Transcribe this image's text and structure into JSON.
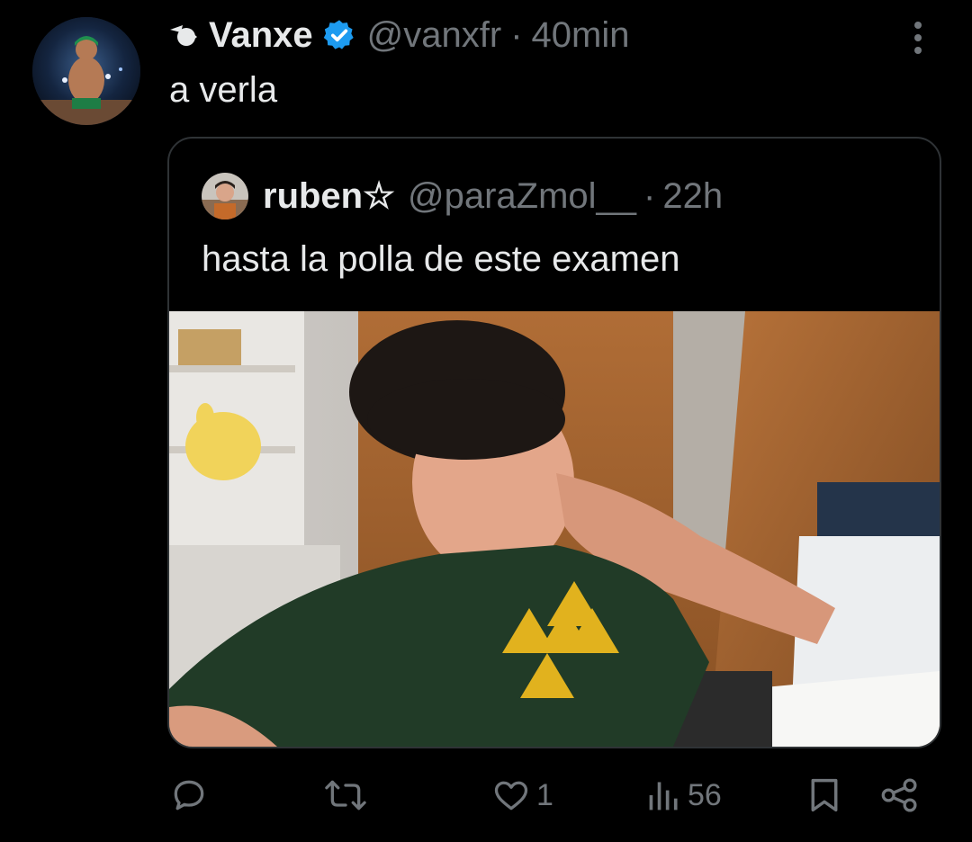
{
  "tweet": {
    "display_name": "Vanxe",
    "handle": "@vanxfr",
    "separator": "·",
    "time": "40min",
    "text": "a verla",
    "verified": true
  },
  "quoted_tweet": {
    "display_name": "ruben☆",
    "handle": "@paraZmol__",
    "separator": "·",
    "time": "22h",
    "text": "hasta la polla de este examen"
  },
  "actions": {
    "reply": {
      "icon": "reply-icon",
      "count": ""
    },
    "retweet": {
      "icon": "retweet-icon",
      "count": ""
    },
    "like": {
      "icon": "heart-icon",
      "count": "1"
    },
    "views": {
      "icon": "views-icon",
      "count": "56"
    },
    "bookmark": {
      "icon": "bookmark-icon"
    },
    "share": {
      "icon": "share-icon"
    }
  },
  "colors": {
    "background": "#000000",
    "text_primary": "#e7e9ea",
    "text_secondary": "#71767b",
    "verified_blue": "#1d9bf0",
    "card_border": "#2f3336"
  }
}
